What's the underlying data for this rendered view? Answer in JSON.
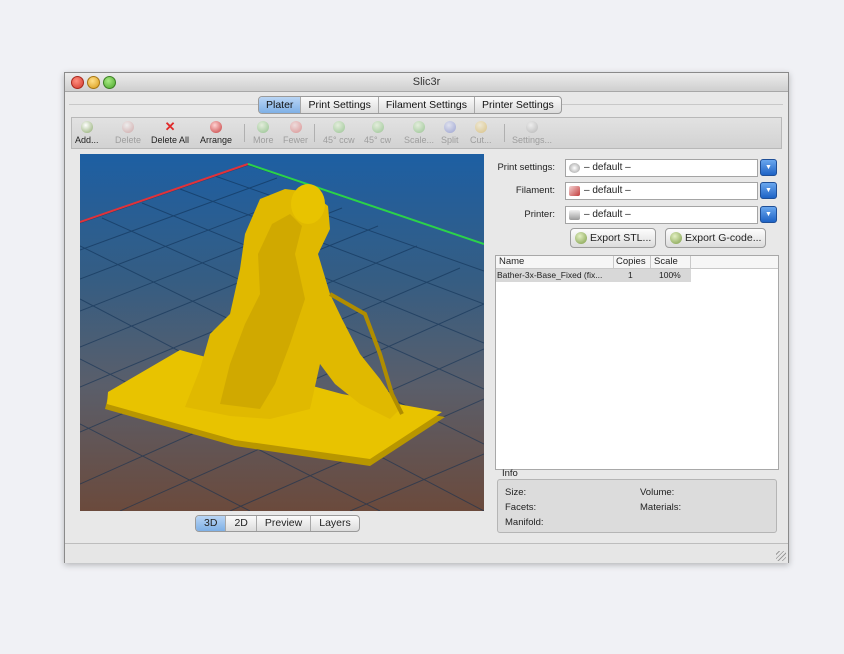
{
  "window": {
    "title": "Slic3r"
  },
  "tabs": [
    "Plater",
    "Print Settings",
    "Filament Settings",
    "Printer Settings"
  ],
  "toolbar": {
    "add": "Add...",
    "delete": "Delete",
    "delete_all": "Delete All",
    "arrange": "Arrange",
    "more": "More",
    "fewer": "Fewer",
    "rotate_ccw": "45° ccw",
    "rotate_cw": "45° cw",
    "scale": "Scale...",
    "split": "Split",
    "cut": "Cut...",
    "settings": "Settings..."
  },
  "view_tabs": [
    "3D",
    "2D",
    "Preview",
    "Layers"
  ],
  "presets": {
    "print_label": "Print settings:",
    "print_value": "– default –",
    "filament_label": "Filament:",
    "filament_value": "– default –",
    "printer_label": "Printer:",
    "printer_value": "– default –"
  },
  "buttons": {
    "export_stl": "Export STL...",
    "export_gcode": "Export G-code..."
  },
  "object_list": {
    "columns": [
      "Name",
      "Copies",
      "Scale"
    ],
    "rows": [
      {
        "name": "Bather-3x-Base_Fixed (fix...",
        "copies": "1",
        "scale": "100%"
      }
    ]
  },
  "info": {
    "title": "Info",
    "size_label": "Size:",
    "volume_label": "Volume:",
    "facets_label": "Facets:",
    "materials_label": "Materials:",
    "manifold_label": "Manifold:"
  },
  "colors": {
    "accent": "#7fb0e6",
    "model": "#e8c300",
    "x_axis": "#e0323a",
    "y_axis": "#2bd24a"
  }
}
